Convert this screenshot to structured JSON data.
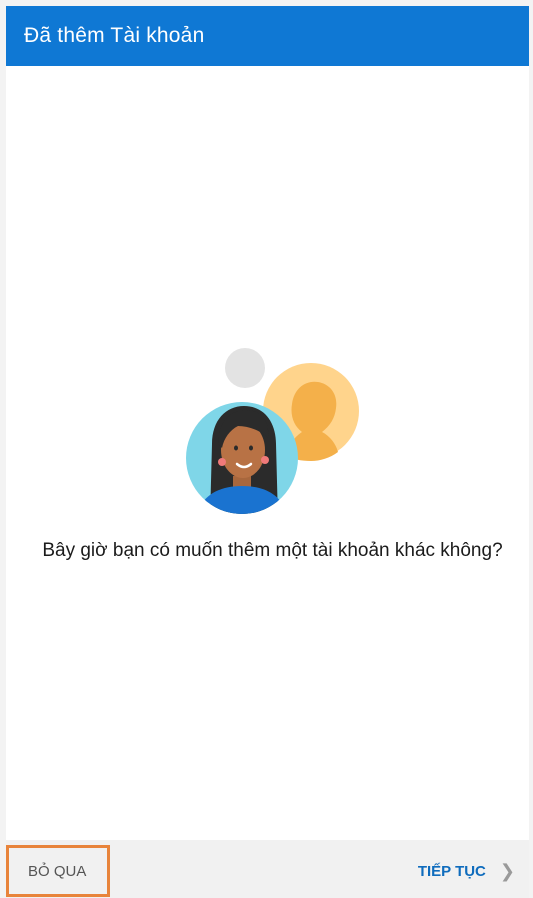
{
  "header": {
    "title": "Đã thêm Tài khoản"
  },
  "main": {
    "prompt": "Bây giờ bạn có muốn thêm một tài khoản khác không?",
    "illustration_icon": "multiple-accounts-illustration"
  },
  "footer": {
    "skip_label": "BỎ QUA",
    "continue_label": "TIẾP TỤC",
    "continue_icon": "chevron-right-icon"
  },
  "colors": {
    "app_bar": "#0f78d4",
    "accent_text": "#0f6cbd",
    "highlight_border": "#e8843b",
    "footer_bg": "#f1f1f1"
  }
}
